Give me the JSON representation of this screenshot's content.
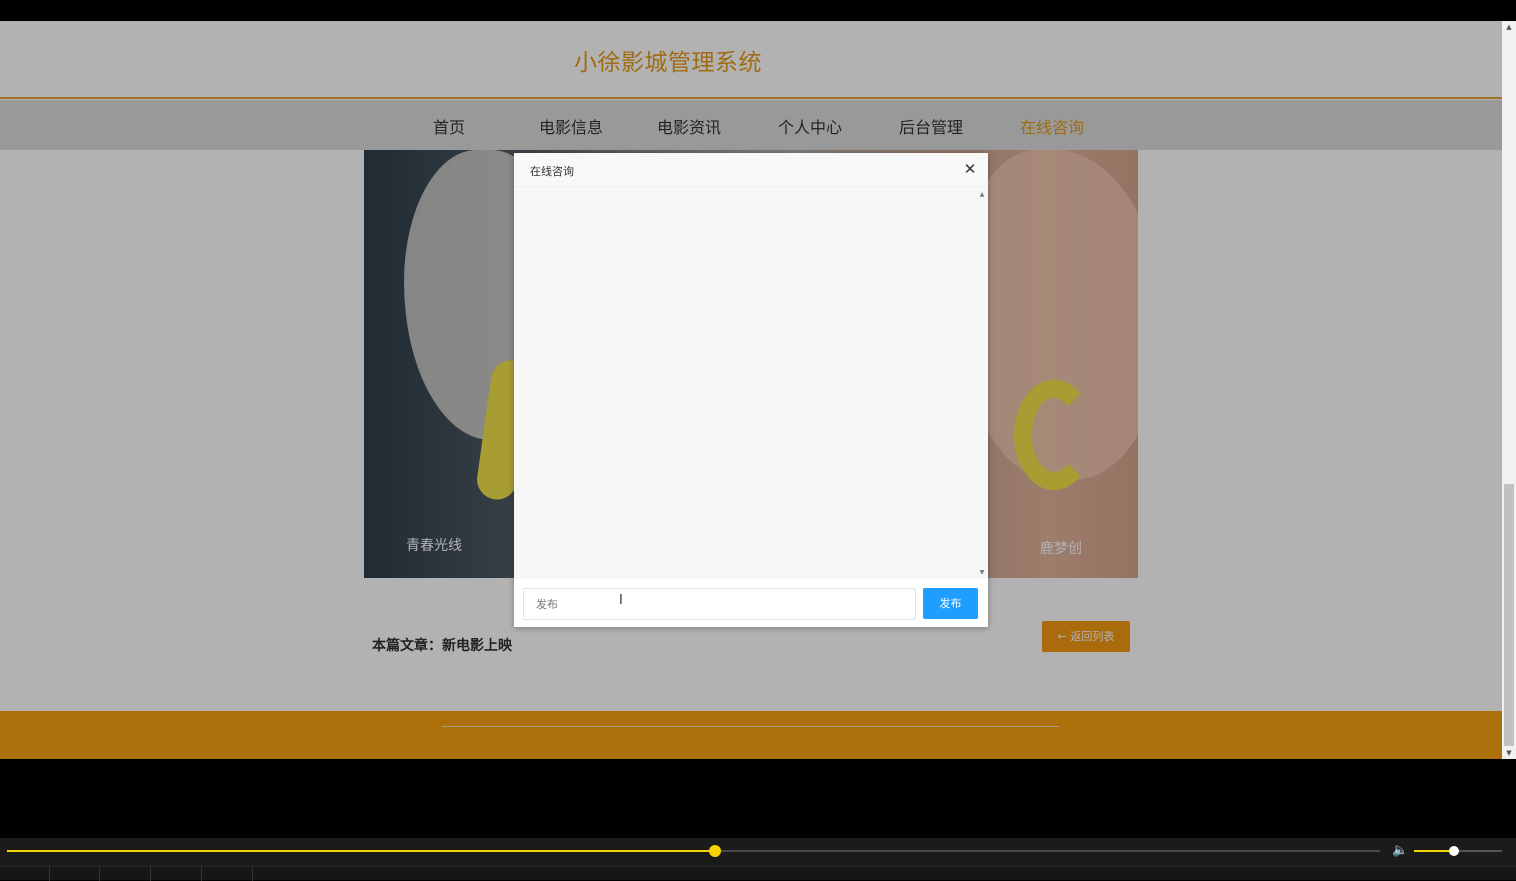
{
  "site": {
    "title": "小徐影城管理系统"
  },
  "nav": {
    "items": [
      {
        "label": "首页"
      },
      {
        "label": "电影信息"
      },
      {
        "label": "电影资讯"
      },
      {
        "label": "个人中心"
      },
      {
        "label": "后台管理"
      },
      {
        "label": "在线咨询",
        "active": true
      }
    ]
  },
  "poster": {
    "left_sig": "青春光线",
    "right_sig": "鹿梦创"
  },
  "article": {
    "label": "本篇文章：新电影上映",
    "back_label": "返回列表"
  },
  "modal": {
    "title": "在线咨询",
    "close_icon": "close-icon",
    "input_placeholder": "发布",
    "send_label": "发布"
  },
  "player": {
    "progress": 0.516,
    "volume": 0.45
  },
  "colors": {
    "accent": "#e69b19",
    "footer": "#f5a10f",
    "send_button": "#1e9fff",
    "player_accent": "#f5d400"
  }
}
